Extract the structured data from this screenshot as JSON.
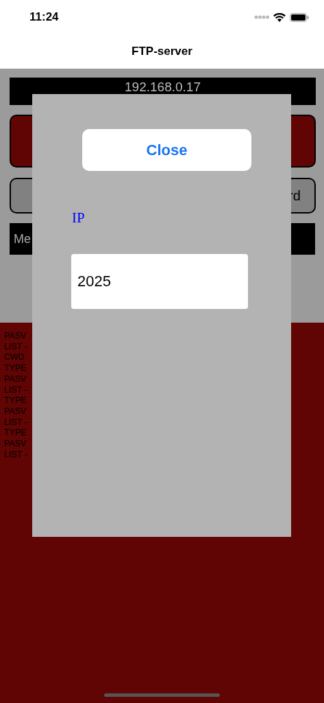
{
  "status_bar": {
    "time": "11:24"
  },
  "nav": {
    "title": "FTP-server"
  },
  "server": {
    "address": "192.168.0.17",
    "password_button": "rd",
    "message_field": "Me"
  },
  "log": [
    "PASV",
    "LIST -",
    "CWD",
    "TYPE",
    "PASV",
    "LIST -",
    "TYPE",
    "PASV",
    "LIST -",
    "TYPE",
    "PASV",
    "LIST -"
  ],
  "dialog": {
    "close_button": "Close",
    "label": "IP",
    "field_value": "2025"
  }
}
